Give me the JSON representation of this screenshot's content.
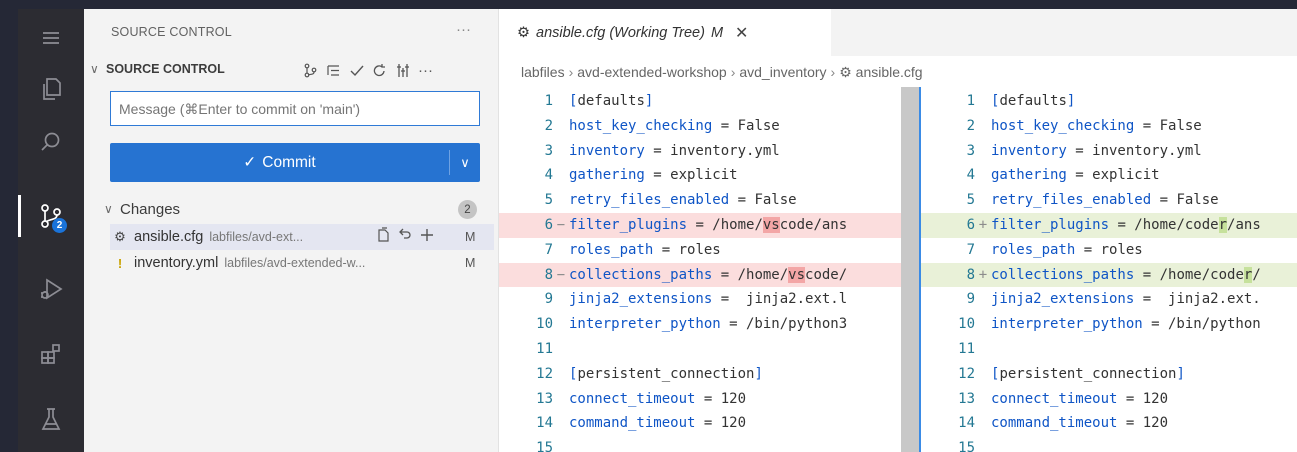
{
  "activity_bar": {
    "items": [
      {
        "name": "menu-icon"
      },
      {
        "name": "explorer-icon"
      },
      {
        "name": "search-icon"
      },
      {
        "name": "source-control-icon",
        "badge": "2",
        "active": true
      },
      {
        "name": "run-debug-icon"
      },
      {
        "name": "extensions-icon"
      },
      {
        "name": "testing-icon"
      }
    ]
  },
  "sidebar": {
    "title": "SOURCE CONTROL",
    "more": "···",
    "section_title": "SOURCE CONTROL",
    "toolbar_icons": [
      "branch-compare-icon",
      "list-view-icon",
      "commit-check-icon",
      "refresh-icon",
      "graph-icon",
      "more-icon"
    ],
    "message_placeholder": "Message (⌘Enter to commit on 'main')",
    "commit_label": "Commit",
    "changes_label": "Changes",
    "changes_count": "2",
    "files": [
      {
        "icon": "⚙",
        "name": "ansible.cfg",
        "path": "labfiles/avd-ext...",
        "status": "M",
        "selected": true
      },
      {
        "icon": "!",
        "name": "inventory.yml",
        "path": "labfiles/avd-extended-w...",
        "status": "M",
        "selected": false
      }
    ]
  },
  "editor": {
    "tab_title": "ansible.cfg (Working Tree)",
    "tab_status": "M",
    "breadcrumbs": [
      "labfiles",
      "avd-extended-workshop",
      "avd_inventory",
      "ansible.cfg"
    ],
    "left": [
      {
        "n": "1",
        "t": "[defaults]"
      },
      {
        "n": "2",
        "t": "host_key_checking = False"
      },
      {
        "n": "3",
        "t": "inventory = inventory.yml"
      },
      {
        "n": "4",
        "t": "gathering = explicit"
      },
      {
        "n": "5",
        "t": "retry_files_enabled = False"
      },
      {
        "n": "6",
        "t": "filter_plugins = /home/vscode/ans"
      },
      {
        "n": "7",
        "t": "roles_path = roles"
      },
      {
        "n": "8",
        "t": "collections_paths = /home/vscode/"
      },
      {
        "n": "9",
        "t": "jinja2_extensions =  jinja2.ext.l"
      },
      {
        "n": "10",
        "t": "interpreter_python = /bin/python3"
      },
      {
        "n": "11",
        "t": ""
      },
      {
        "n": "12",
        "t": "[persistent_connection]"
      },
      {
        "n": "13",
        "t": "connect_timeout = 120"
      },
      {
        "n": "14",
        "t": "command_timeout = 120"
      },
      {
        "n": "15",
        "t": ""
      }
    ],
    "right": [
      {
        "n": "1",
        "t": "[defaults]"
      },
      {
        "n": "2",
        "t": "host_key_checking = False"
      },
      {
        "n": "3",
        "t": "inventory = inventory.yml"
      },
      {
        "n": "4",
        "t": "gathering = explicit"
      },
      {
        "n": "5",
        "t": "retry_files_enabled = False"
      },
      {
        "n": "6",
        "t": "filter_plugins = /home/coder/ans"
      },
      {
        "n": "7",
        "t": "roles_path = roles"
      },
      {
        "n": "8",
        "t": "collections_paths = /home/coder/"
      },
      {
        "n": "9",
        "t": "jinja2_extensions =  jinja2.ext."
      },
      {
        "n": "10",
        "t": "interpreter_python = /bin/python"
      },
      {
        "n": "11",
        "t": ""
      },
      {
        "n": "12",
        "t": "[persistent_connection]"
      },
      {
        "n": "13",
        "t": "connect_timeout = 120"
      },
      {
        "n": "14",
        "t": "command_timeout = 120"
      },
      {
        "n": "15",
        "t": ""
      }
    ],
    "changed_lines": {
      "left": [
        "6",
        "8"
      ],
      "right": [
        "6",
        "8"
      ]
    },
    "changed_words": {
      "left": "vs",
      "right": "r"
    },
    "gutter_marks": {
      "left": "−",
      "right": "+"
    },
    "arrow": "→"
  },
  "colors": {
    "accent": "#2673d1",
    "deleted_bg": "#fbdddd",
    "added_bg": "#e9f1d8"
  }
}
